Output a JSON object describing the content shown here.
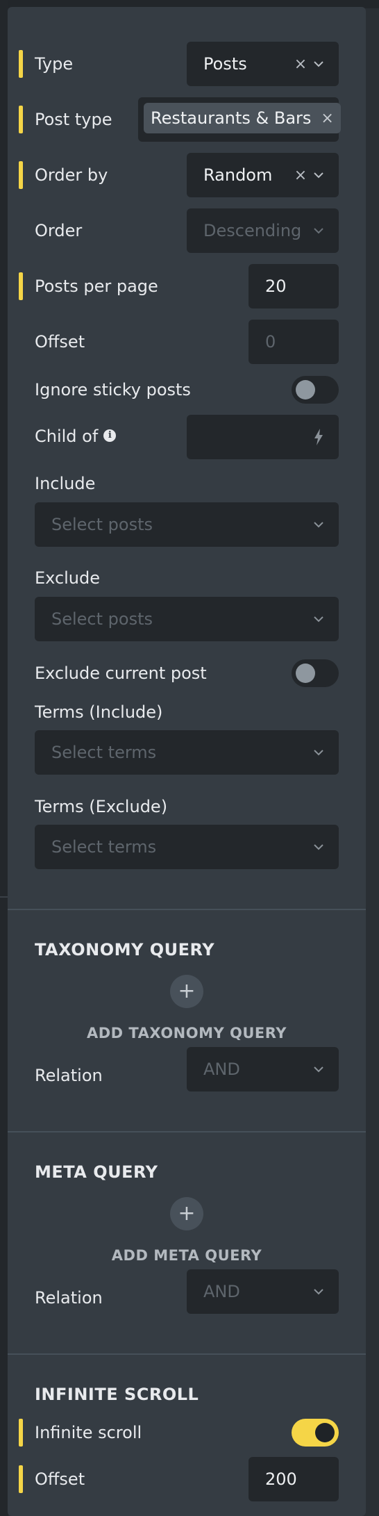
{
  "query": {
    "type": {
      "label": "Type",
      "value": "Posts"
    },
    "post_type": {
      "label": "Post type",
      "tag": "Restaurants & Bars"
    },
    "order_by": {
      "label": "Order by",
      "value": "Random"
    },
    "order": {
      "label": "Order",
      "placeholder": "Descending"
    },
    "posts_per_page": {
      "label": "Posts per page",
      "value": "20"
    },
    "offset": {
      "label": "Offset",
      "placeholder": "0"
    },
    "ignore_sticky": {
      "label": "Ignore sticky posts",
      "enabled": false
    },
    "child_of": {
      "label": "Child of"
    },
    "include": {
      "label": "Include",
      "placeholder": "Select posts"
    },
    "exclude": {
      "label": "Exclude",
      "placeholder": "Select posts"
    },
    "exclude_current": {
      "label": "Exclude current post",
      "enabled": false
    },
    "terms_include": {
      "label": "Terms (Include)",
      "placeholder": "Select terms"
    },
    "terms_exclude": {
      "label": "Terms (Exclude)",
      "placeholder": "Select terms"
    }
  },
  "taxonomy_query": {
    "title": "TAXONOMY QUERY",
    "add_label": "ADD TAXONOMY QUERY",
    "relation_label": "Relation",
    "relation_placeholder": "AND"
  },
  "meta_query": {
    "title": "META QUERY",
    "add_label": "ADD META QUERY",
    "relation_label": "Relation",
    "relation_placeholder": "AND"
  },
  "infinite_scroll": {
    "title": "INFINITE SCROLL",
    "toggle_label": "Infinite scroll",
    "enabled": true,
    "offset_label": "Offset",
    "offset_value": "200"
  },
  "icons": {
    "clear": "×",
    "add": "+",
    "info": "i"
  },
  "colors": {
    "accent": "#f5d547",
    "panel": "#353c43",
    "control": "#23272b"
  }
}
